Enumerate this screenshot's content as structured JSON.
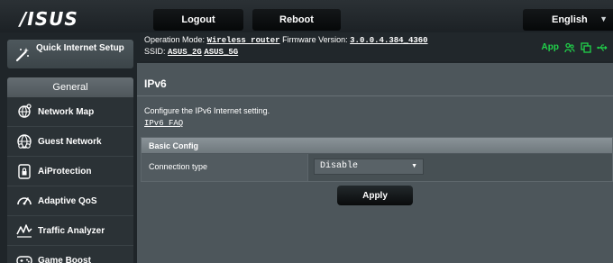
{
  "header": {
    "logo": "/ISUS",
    "logout_label": "Logout",
    "reboot_label": "Reboot",
    "language": {
      "selected": "English"
    }
  },
  "status": {
    "operation_mode_label": "Operation Mode:",
    "operation_mode_value": "Wireless router",
    "firmware_label": "Firmware Version:",
    "firmware_value": "3.0.0.4.384_4360",
    "ssid_label": "SSID:",
    "ssid_2g": "ASUS_2G",
    "ssid_5g": "ASUS_5G",
    "app_label": "App",
    "icons": [
      "users-icon",
      "copy-icon",
      "usb-icon"
    ],
    "icon_color": "#21d24a"
  },
  "sidebar": {
    "qis_label": "Quick Internet Setup",
    "section_title": "General",
    "items": [
      {
        "label": "Network Map",
        "icon": "network-map-icon"
      },
      {
        "label": "Guest Network",
        "icon": "guest-network-icon"
      },
      {
        "label": "AiProtection",
        "icon": "aiprotection-icon"
      },
      {
        "label": "Adaptive QoS",
        "icon": "adaptive-qos-icon"
      },
      {
        "label": "Traffic Analyzer",
        "icon": "traffic-analyzer-icon"
      },
      {
        "label": "Game Boost",
        "icon": "game-boost-icon"
      }
    ]
  },
  "main": {
    "title": "IPv6",
    "description": "Configure the IPv6 Internet setting.",
    "faq_link": "IPv6 FAQ",
    "table": {
      "header": "Basic Config",
      "rows": [
        {
          "label": "Connection type",
          "value": "Disable"
        }
      ]
    },
    "apply_label": "Apply"
  }
}
